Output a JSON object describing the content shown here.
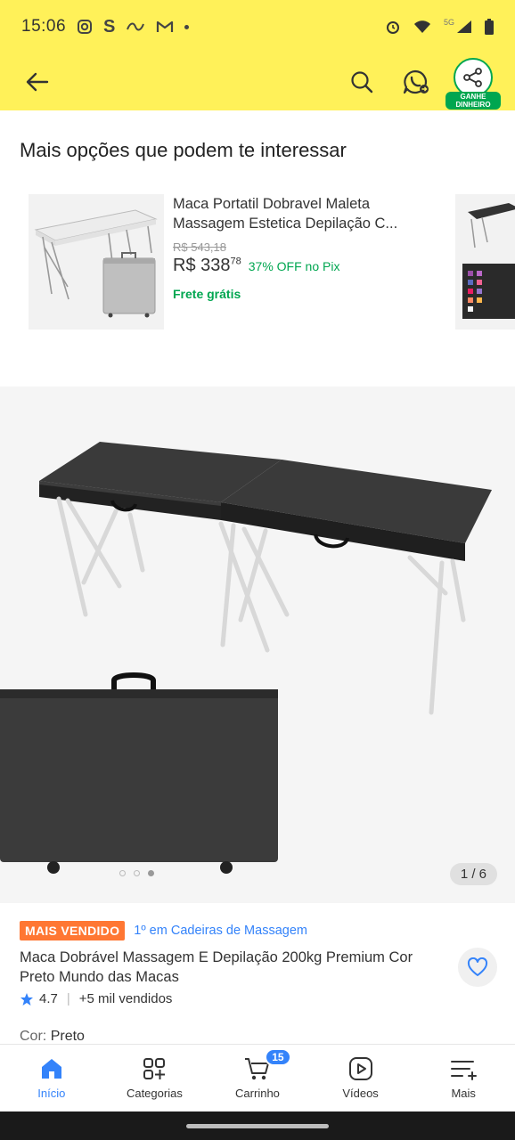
{
  "status_bar": {
    "time": "15:06",
    "app_icons": [
      "instagram-icon",
      "s-app-icon",
      "app-icon",
      "gmail-icon"
    ],
    "network": "5G"
  },
  "top_bar": {
    "share_badge": "GANHE DINHEIRO"
  },
  "recommendations": {
    "title": "Mais opções que podem te interessar",
    "item": {
      "title": "Maca Portatil Dobravel Maleta Massagem Estetica Depilação C...",
      "old_price": "R$ 543,18",
      "price": "R$ 338",
      "price_cents": "78",
      "discount": "37% OFF no Pix",
      "shipping": "Frete grátis"
    }
  },
  "gallery": {
    "pager": "1 / 6",
    "dots": 3,
    "active_dot": 2
  },
  "product": {
    "badge": "MAIS VENDIDO",
    "rank": "1º em Cadeiras de Massagem",
    "title": "Maca Dobrável Massagem E Depilação 200kg Premium Cor Preto Mundo das Macas",
    "rating": "4.7",
    "sold": "+5 mil vendidos",
    "color_label": "Cor:",
    "color_value": "Preto"
  },
  "bottom_nav": {
    "items": [
      {
        "label": "Início",
        "icon": "home-icon"
      },
      {
        "label": "Categorias",
        "icon": "categories-icon"
      },
      {
        "label": "Carrinho",
        "icon": "cart-icon"
      },
      {
        "label": "Vídeos",
        "icon": "video-icon"
      },
      {
        "label": "Mais",
        "icon": "menu-icon"
      }
    ],
    "cart_count": "15"
  },
  "colors": {
    "brand_yellow": "#fff159",
    "accent_blue": "#3483fa",
    "green": "#00a650",
    "orange": "#ff7733"
  }
}
